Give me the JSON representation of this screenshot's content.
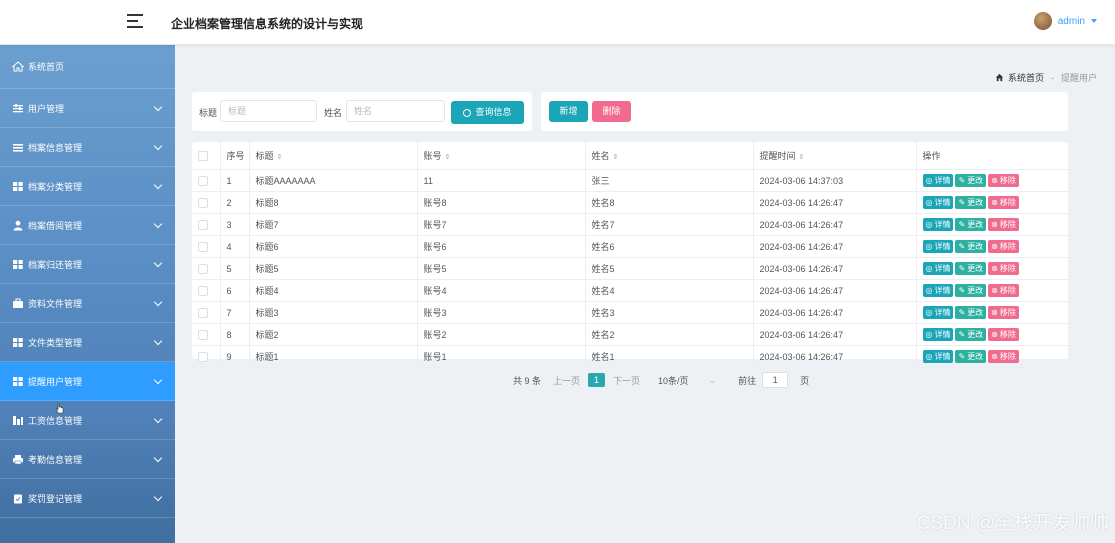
{
  "header": {
    "title": "企业档案管理信息系统的设计与实现",
    "user": "admin"
  },
  "sidebar": {
    "items": [
      {
        "label": "系统首页",
        "icon": "home-icon"
      },
      {
        "label": "用户管理",
        "icon": "sliders-icon"
      },
      {
        "label": "档案信息管理",
        "icon": "list-icon"
      },
      {
        "label": "档案分类管理",
        "icon": "grid-icon"
      },
      {
        "label": "档案借阅管理",
        "icon": "user-icon"
      },
      {
        "label": "档案归还管理",
        "icon": "grid-icon"
      },
      {
        "label": "资料文件管理",
        "icon": "briefcase-icon"
      },
      {
        "label": "文件类型管理",
        "icon": "grid-icon"
      },
      {
        "label": "提醒用户管理",
        "icon": "grid-icon",
        "active": true
      },
      {
        "label": "工资信息管理",
        "icon": "bar-icon"
      },
      {
        "label": "考勤信息管理",
        "icon": "printer-icon"
      },
      {
        "label": "奖罚登记管理",
        "icon": "clipboard-icon"
      }
    ]
  },
  "breadcrumb": {
    "home": "系统首页",
    "separator": "-",
    "current": "提醒用户"
  },
  "search": {
    "title_label": "标题",
    "title_placeholder": "标题",
    "name_label": "姓名",
    "name_placeholder": "姓名",
    "query_button": "查询信息"
  },
  "actions": {
    "add": "新增",
    "delete": "删除"
  },
  "table": {
    "columns": [
      "序号",
      "标题",
      "账号",
      "姓名",
      "提醒时间",
      "操作"
    ],
    "rows": [
      {
        "no": "1",
        "title": "标题AAAAAAA",
        "account": "11",
        "name": "张三",
        "time": "2024-03-06 14:37:03"
      },
      {
        "no": "2",
        "title": "标题8",
        "account": "账号8",
        "name": "姓名8",
        "time": "2024-03-06 14:26:47"
      },
      {
        "no": "3",
        "title": "标题7",
        "account": "账号7",
        "name": "姓名7",
        "time": "2024-03-06 14:26:47"
      },
      {
        "no": "4",
        "title": "标题6",
        "account": "账号6",
        "name": "姓名6",
        "time": "2024-03-06 14:26:47"
      },
      {
        "no": "5",
        "title": "标题5",
        "account": "账号5",
        "name": "姓名5",
        "time": "2024-03-06 14:26:47"
      },
      {
        "no": "6",
        "title": "标题4",
        "account": "账号4",
        "name": "姓名4",
        "time": "2024-03-06 14:26:47"
      },
      {
        "no": "7",
        "title": "标题3",
        "account": "账号3",
        "name": "姓名3",
        "time": "2024-03-06 14:26:47"
      },
      {
        "no": "8",
        "title": "标题2",
        "account": "账号2",
        "name": "姓名2",
        "time": "2024-03-06 14:26:47"
      },
      {
        "no": "9",
        "title": "标题1",
        "account": "账号1",
        "name": "姓名1",
        "time": "2024-03-06 14:26:47"
      }
    ],
    "row_actions": {
      "detail": "详情",
      "edit": "更改",
      "remove": "移除"
    }
  },
  "pagination": {
    "total": "共 9 条",
    "prev": "上一页",
    "current_page": "1",
    "next": "下一页",
    "page_size": "10条/页",
    "goto_label": "前往",
    "goto_value": "1",
    "goto_suffix": "页"
  },
  "watermark": "CSDN @全栈开发帅帅",
  "colors": {
    "sidebar_active": "#2f9cff",
    "query_button": "#1ba6b8",
    "add_button": "#1ba6b8",
    "delete_button": "#f16b8f",
    "detail_button": "#1ba6b8",
    "edit_button": "#2cb1a0",
    "remove_button": "#f16b8f",
    "accent": "#409eff"
  }
}
